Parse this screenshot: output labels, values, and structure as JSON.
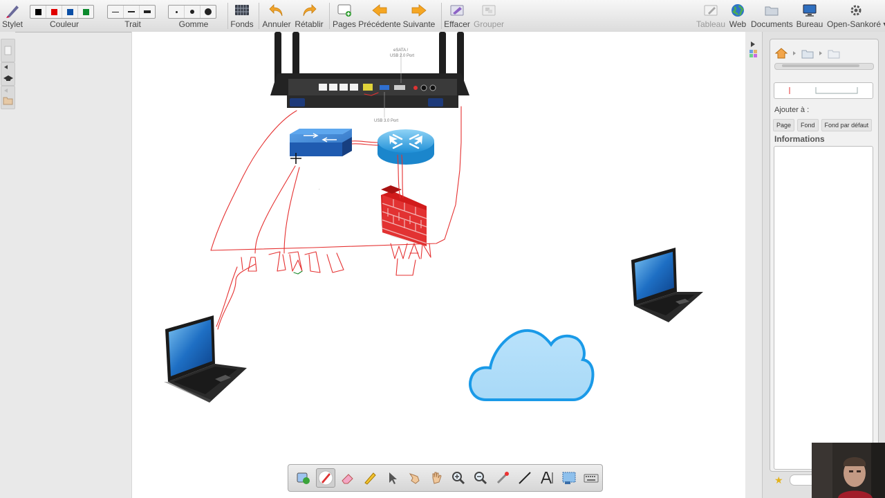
{
  "toolbar": {
    "stylet": "Stylet",
    "couleur": "Couleur",
    "trait": "Trait",
    "gomme": "Gomme",
    "fonds": "Fonds",
    "annuler": "Annuler",
    "retablir": "Rétablir",
    "pages": "Pages",
    "precedente": "Précédente",
    "suivante": "Suivante",
    "effacer": "Effacer",
    "grouper": "Grouper",
    "tableau": "Tableau",
    "web": "Web",
    "documents": "Documents",
    "bureau": "Bureau",
    "open_sankore": "Open-Sankoré"
  },
  "colors": {
    "palette": [
      "#000000",
      "#e00000",
      "#0b4fa6",
      "#0b8a2d"
    ],
    "ink": "#e53030"
  },
  "board": {
    "router_labels": {
      "esata": "eSATA /",
      "usb2": "USB 2.0 Port",
      "usb3": "USB 3.0 Port"
    },
    "handwriting": {
      "ports": "1 2 3 4 L",
      "wan": "WAN"
    }
  },
  "library": {
    "add_to_label": "Ajouter à :",
    "buttons": [
      "Page",
      "Fond",
      "Fond par défaut"
    ],
    "info_title": "Informations"
  },
  "bottom_tools": [
    "interactor-icon",
    "stylus-icon",
    "eraser-icon",
    "highlighter-icon",
    "pointer-icon",
    "laser-hand-icon",
    "hand-icon",
    "zoom-in-icon",
    "zoom-out-icon",
    "laser-pointer-icon",
    "line-icon",
    "text-icon",
    "capture-icon",
    "keyboard-icon"
  ]
}
